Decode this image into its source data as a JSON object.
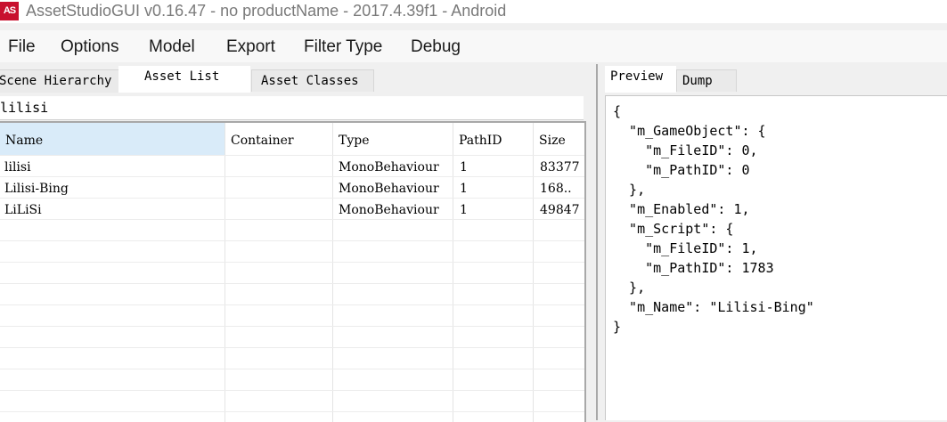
{
  "window": {
    "icon_text": "AS",
    "title": "AssetStudioGUI v0.16.47 - no productName - 2017.4.39f1 - Android"
  },
  "menu": [
    "File",
    "Options",
    "Model",
    "Export",
    "Filter Type",
    "Debug"
  ],
  "left_tabs": [
    "Scene Hierarchy",
    "Asset List",
    "Asset Classes"
  ],
  "filter_value": "lilisi",
  "columns": [
    "Name",
    "Container",
    "Type",
    "PathID",
    "Size"
  ],
  "rows": [
    {
      "name": "lilisi",
      "container": "",
      "type": "MonoBehaviour",
      "pathid": "1",
      "size": "83377"
    },
    {
      "name": "Lilisi-Bing",
      "container": "",
      "type": "MonoBehaviour",
      "pathid": "1",
      "size": "168.."
    },
    {
      "name": "LiLiSi",
      "container": "",
      "type": "MonoBehaviour",
      "pathid": "1",
      "size": "49847"
    }
  ],
  "right_tabs": [
    "Preview",
    "Dump"
  ],
  "preview_lines": [
    "{",
    "  \"m_GameObject\": {",
    "    \"m_FileID\": 0,",
    "    \"m_PathID\": 0",
    "  },",
    "  \"m_Enabled\": 1,",
    "  \"m_Script\": {",
    "    \"m_FileID\": 1,",
    "    \"m_PathID\": 1783",
    "  },",
    "  \"m_Name\": \"Lilisi-Bing\"",
    "}"
  ]
}
